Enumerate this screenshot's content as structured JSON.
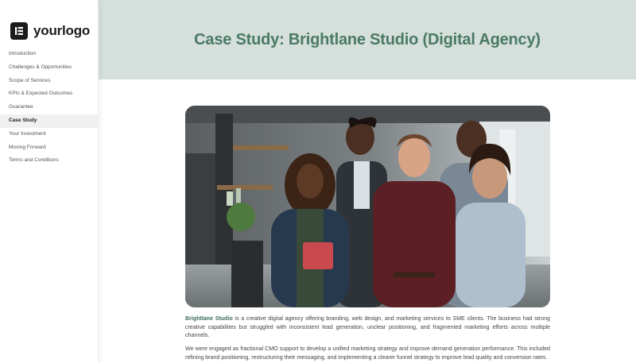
{
  "logo": {
    "text": "yourlogo",
    "icon": "elementor-icon"
  },
  "nav": {
    "items": [
      {
        "label": "Introduction",
        "active": false
      },
      {
        "label": "Challenges & Opportunities",
        "active": false
      },
      {
        "label": "Scope of Services",
        "active": false
      },
      {
        "label": "KPIs & Expected Outcomes",
        "active": false
      },
      {
        "label": "Guarantee",
        "active": false
      },
      {
        "label": "Case Study",
        "active": true
      },
      {
        "label": "Your Investment",
        "active": false
      },
      {
        "label": "Moving Forward",
        "active": false
      },
      {
        "label": "Terms and Conditions",
        "active": false
      }
    ]
  },
  "header": {
    "title": "Case Study: Brightlane Studio (Digital Agency)"
  },
  "photo": {
    "alt": "team-photo"
  },
  "content": {
    "brand_name": "Brightlane Studio",
    "paragraph1_rest": " is a creative digital agency offering branding, web design, and marketing services to SME clients. The business had strong creative capabilities but struggled with inconsistent lead generation, unclear positioning, and fragmented marketing efforts across multiple channels.",
    "paragraph2": "We were engaged as fractional CMO support to develop a unified marketing strategy and improve demand generation performance. This included refining brand positioning, restructuring their messaging, and implementing a clearer funnel strategy to improve lead quality and conversion rates."
  },
  "colors": {
    "accent": "#4a7a64",
    "banner_bg": "#d5dfdb",
    "logo_dark": "#1c1c1c"
  }
}
